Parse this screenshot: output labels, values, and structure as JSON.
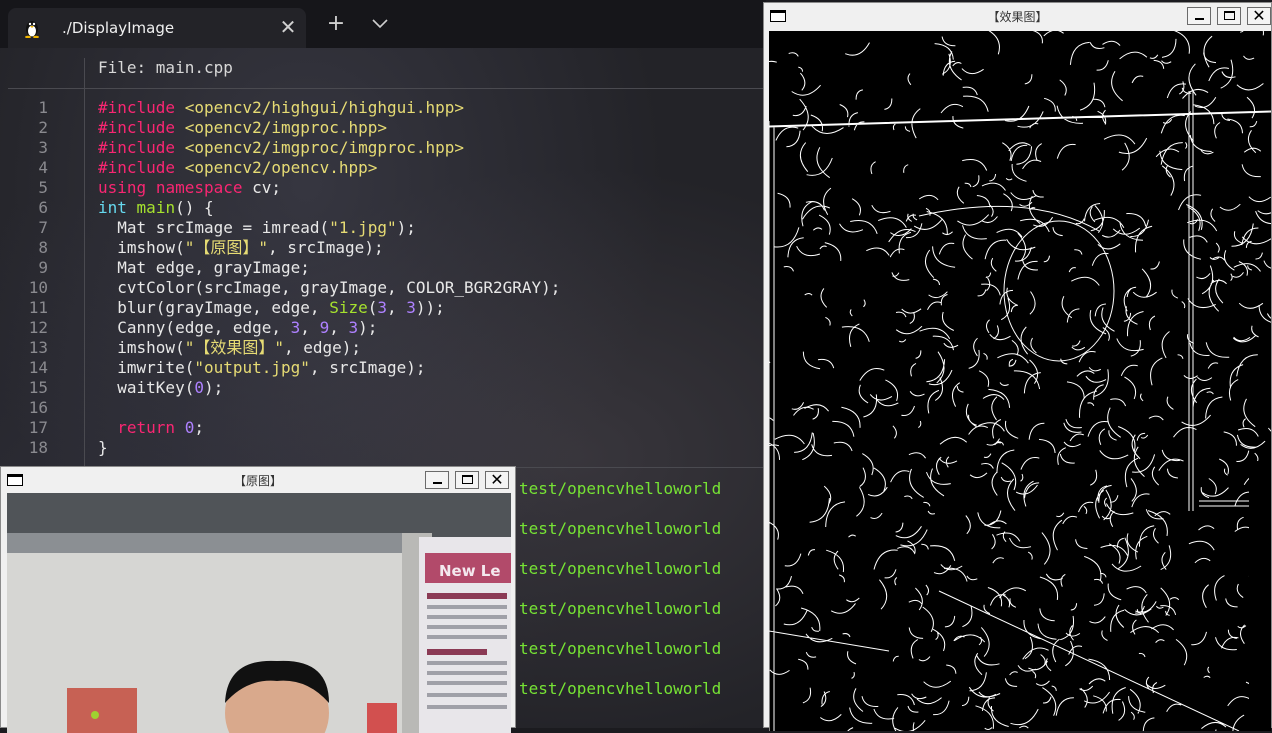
{
  "terminal": {
    "tab_title": "./DisplayImage",
    "tab_close": "✕",
    "new_tab": "+",
    "file_header": "File: main.cpp",
    "line_numbers": [
      "1",
      "2",
      "3",
      "4",
      "5",
      "6",
      "7",
      "8",
      "9",
      "10",
      "11",
      "12",
      "13",
      "14",
      "15",
      "16",
      "17",
      "18"
    ],
    "code": [
      "#include <opencv2/highgui/highgui.hpp>",
      "#include <opencv2/imgproc.hpp>",
      "#include <opencv2/imgproc/imgproc.hpp>",
      "#include <opencv2/opencv.hpp>",
      "using namespace cv;",
      "int main() {",
      "  Mat srcImage = imread(\"1.jpg\");",
      "  imshow(\"【原图】\", srcImage);",
      "  Mat edge, grayImage;",
      "  cvtColor(srcImage, grayImage, COLOR_BGR2GRAY);",
      "  blur(grayImage, edge, Size(3, 3));",
      "  Canny(edge, edge, 3, 9, 3);",
      "  imshow(\"【效果图】\", edge);",
      "  imwrite(\"output.jpg\", srcImage);",
      "  waitKey(0);",
      "",
      "  return 0;",
      "}"
    ],
    "output_lines": [
      "test/opencvhelloworld",
      "test/opencvhelloworld",
      "test/opencvhelloworld",
      "test/opencvhelloworld",
      "test/opencvhelloworld",
      "test/opencvhelloworld"
    ]
  },
  "original_window": {
    "title": "【原图】",
    "min": "",
    "max": "",
    "close": "✕"
  },
  "effect_window": {
    "title": "【效果图】",
    "close": "✕"
  },
  "colors": {
    "keyword_pink": "#f92672",
    "keyword_blue": "#66d9ef",
    "string": "#e6db74",
    "number": "#ae81ff",
    "function_green": "#a6e22e",
    "output_green": "#76e334"
  }
}
